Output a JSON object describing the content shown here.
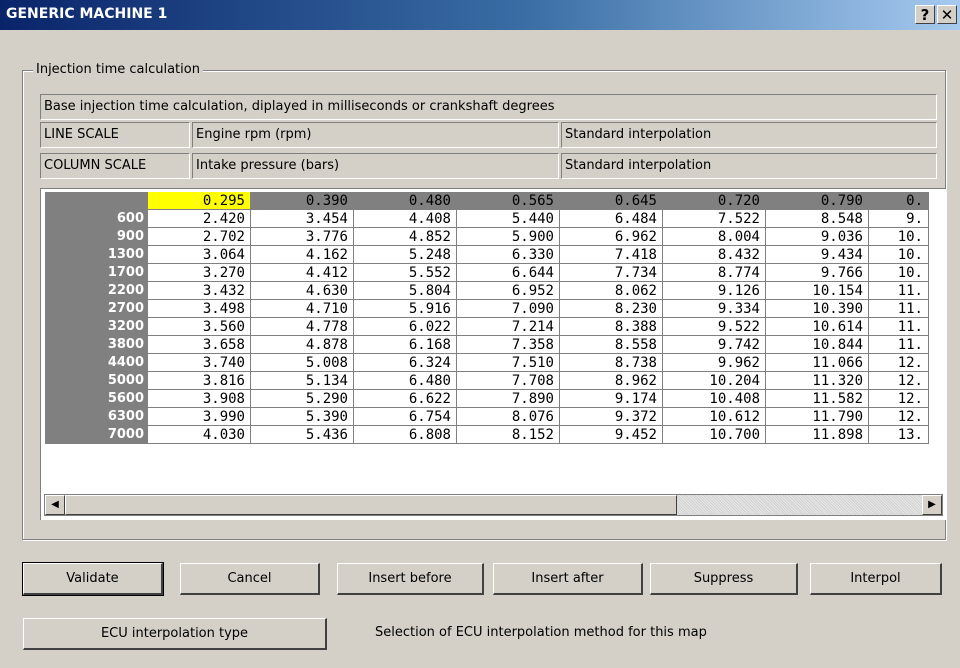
{
  "window": {
    "title": "GENERIC MACHINE 1",
    "help_label": "?",
    "close_label": "✕"
  },
  "group": {
    "label": "Injection time calculation"
  },
  "info": {
    "description": "Base injection time calculation, diplayed in milliseconds or crankshaft degrees",
    "line_scale_label": "LINE SCALE",
    "line_scale_name": "Engine rpm (rpm)",
    "line_scale_interp": "Standard interpolation",
    "column_scale_label": "COLUMN SCALE",
    "column_scale_name": "Intake pressure (bars)",
    "column_scale_interp": "Standard interpolation"
  },
  "table": {
    "columns": [
      "0.295",
      "0.390",
      "0.480",
      "0.565",
      "0.645",
      "0.720",
      "0.790",
      "0."
    ],
    "rows": [
      {
        "rpm": "600",
        "values": [
          "2.420",
          "3.454",
          "4.408",
          "5.440",
          "6.484",
          "7.522",
          "8.548",
          "9."
        ]
      },
      {
        "rpm": "900",
        "values": [
          "2.702",
          "3.776",
          "4.852",
          "5.900",
          "6.962",
          "8.004",
          "9.036",
          "10."
        ]
      },
      {
        "rpm": "1300",
        "values": [
          "3.064",
          "4.162",
          "5.248",
          "6.330",
          "7.418",
          "8.432",
          "9.434",
          "10."
        ]
      },
      {
        "rpm": "1700",
        "values": [
          "3.270",
          "4.412",
          "5.552",
          "6.644",
          "7.734",
          "8.774",
          "9.766",
          "10."
        ]
      },
      {
        "rpm": "2200",
        "values": [
          "3.432",
          "4.630",
          "5.804",
          "6.952",
          "8.062",
          "9.126",
          "10.154",
          "11."
        ]
      },
      {
        "rpm": "2700",
        "values": [
          "3.498",
          "4.710",
          "5.916",
          "7.090",
          "8.230",
          "9.334",
          "10.390",
          "11."
        ]
      },
      {
        "rpm": "3200",
        "values": [
          "3.560",
          "4.778",
          "6.022",
          "7.214",
          "8.388",
          "9.522",
          "10.614",
          "11."
        ]
      },
      {
        "rpm": "3800",
        "values": [
          "3.658",
          "4.878",
          "6.168",
          "7.358",
          "8.558",
          "9.742",
          "10.844",
          "11."
        ]
      },
      {
        "rpm": "4400",
        "values": [
          "3.740",
          "5.008",
          "6.324",
          "7.510",
          "8.738",
          "9.962",
          "11.066",
          "12."
        ]
      },
      {
        "rpm": "5000",
        "values": [
          "3.816",
          "5.134",
          "6.480",
          "7.708",
          "8.962",
          "10.204",
          "11.320",
          "12."
        ]
      },
      {
        "rpm": "5600",
        "values": [
          "3.908",
          "5.290",
          "6.622",
          "7.890",
          "9.174",
          "10.408",
          "11.582",
          "12."
        ]
      },
      {
        "rpm": "6300",
        "values": [
          "3.990",
          "5.390",
          "6.754",
          "8.076",
          "9.372",
          "10.612",
          "11.790",
          "12."
        ]
      },
      {
        "rpm": "7000",
        "values": [
          "4.030",
          "5.436",
          "6.808",
          "8.152",
          "9.452",
          "10.700",
          "11.898",
          "13."
        ]
      }
    ]
  },
  "scrollbar": {
    "left_arrow": "◀",
    "right_arrow": "▶"
  },
  "buttons": {
    "validate": "Validate",
    "cancel": "Cancel",
    "insert_before": "Insert before",
    "insert_after": "Insert after",
    "suppress": "Suppress",
    "interpol": "Interpol",
    "ecu_interpolation": "ECU interpolation type"
  },
  "hint": "Selection of ECU interpolation method for this map",
  "colors": {
    "selected_cell": "#ffff00",
    "header": "#808080",
    "face": "#d4d0c8"
  }
}
